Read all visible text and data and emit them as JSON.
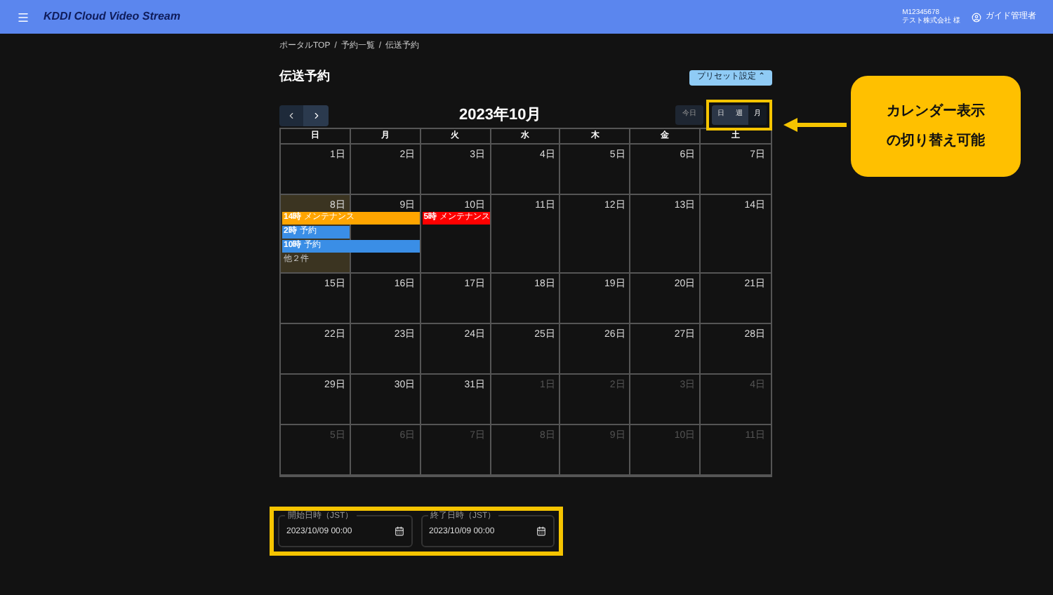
{
  "header": {
    "brand": "KDDI Cloud Video Stream",
    "account_id": "M12345678",
    "company": "テスト株式会社 様",
    "user": "ガイド管理者"
  },
  "breadcrumb": [
    "ポータルTOP",
    "予約一覧",
    "伝送予約"
  ],
  "breadcrumb_separator": "/",
  "page_title": "伝送予約",
  "preset_button": "プリセット設定 ⌃",
  "calendar": {
    "title": "2023年10月",
    "today_button": "今日",
    "views": [
      {
        "label": "日",
        "selected": false
      },
      {
        "label": "週",
        "selected": false
      },
      {
        "label": "月",
        "selected": true
      }
    ],
    "weekdays": [
      "日",
      "月",
      "火",
      "水",
      "木",
      "金",
      "土"
    ],
    "weeks": [
      {
        "days": [
          {
            "label": "1日",
            "muted": false,
            "today": false
          },
          {
            "label": "2日",
            "muted": false,
            "today": false
          },
          {
            "label": "3日",
            "muted": false,
            "today": false
          },
          {
            "label": "4日",
            "muted": false,
            "today": false
          },
          {
            "label": "5日",
            "muted": false,
            "today": false
          },
          {
            "label": "6日",
            "muted": false,
            "today": false
          },
          {
            "label": "7日",
            "muted": false,
            "today": false
          }
        ]
      },
      {
        "days": [
          {
            "label": "8日",
            "muted": false,
            "today": true,
            "events": [
              {
                "time": "14時",
                "title": "メンテナンス",
                "color": "#ffa500",
                "continues": true
              },
              {
                "time": "2時",
                "title": "予約",
                "color": "#3a8ee6",
                "continues": false
              },
              {
                "time": "10時",
                "title": "予約",
                "color": "#3a8ee6",
                "continues": true
              }
            ],
            "more": "他２件"
          },
          {
            "label": "9日",
            "muted": false,
            "today": false
          },
          {
            "label": "10日",
            "muted": false,
            "today": false,
            "events": [
              {
                "time": "5時",
                "title": "メンテナンス",
                "color": "#ff0000",
                "continues": false
              }
            ]
          },
          {
            "label": "11日",
            "muted": false,
            "today": false
          },
          {
            "label": "12日",
            "muted": false,
            "today": false
          },
          {
            "label": "13日",
            "muted": false,
            "today": false
          },
          {
            "label": "14日",
            "muted": false,
            "today": false
          }
        ]
      },
      {
        "days": [
          {
            "label": "15日",
            "muted": false,
            "today": false
          },
          {
            "label": "16日",
            "muted": false,
            "today": false
          },
          {
            "label": "17日",
            "muted": false,
            "today": false
          },
          {
            "label": "18日",
            "muted": false,
            "today": false
          },
          {
            "label": "19日",
            "muted": false,
            "today": false
          },
          {
            "label": "20日",
            "muted": false,
            "today": false
          },
          {
            "label": "21日",
            "muted": false,
            "today": false
          }
        ]
      },
      {
        "days": [
          {
            "label": "22日",
            "muted": false,
            "today": false
          },
          {
            "label": "23日",
            "muted": false,
            "today": false
          },
          {
            "label": "24日",
            "muted": false,
            "today": false
          },
          {
            "label": "25日",
            "muted": false,
            "today": false
          },
          {
            "label": "26日",
            "muted": false,
            "today": false
          },
          {
            "label": "27日",
            "muted": false,
            "today": false
          },
          {
            "label": "28日",
            "muted": false,
            "today": false
          }
        ]
      },
      {
        "days": [
          {
            "label": "29日",
            "muted": false,
            "today": false
          },
          {
            "label": "30日",
            "muted": false,
            "today": false
          },
          {
            "label": "31日",
            "muted": false,
            "today": false
          },
          {
            "label": "1日",
            "muted": true,
            "today": false
          },
          {
            "label": "2日",
            "muted": true,
            "today": false
          },
          {
            "label": "3日",
            "muted": true,
            "today": false
          },
          {
            "label": "4日",
            "muted": true,
            "today": false
          }
        ]
      },
      {
        "days": [
          {
            "label": "5日",
            "muted": true,
            "today": false
          },
          {
            "label": "6日",
            "muted": true,
            "today": false
          },
          {
            "label": "7日",
            "muted": true,
            "today": false
          },
          {
            "label": "8日",
            "muted": true,
            "today": false
          },
          {
            "label": "9日",
            "muted": true,
            "today": false
          },
          {
            "label": "10日",
            "muted": true,
            "today": false
          },
          {
            "label": "11日",
            "muted": true,
            "today": false
          }
        ]
      }
    ]
  },
  "date_fields": [
    {
      "label": "開始日時（JST）",
      "value": "2023/10/09 00:00"
    },
    {
      "label": "終了日時（JST）",
      "value": "2023/10/09 00:00"
    }
  ],
  "callout": {
    "lines": [
      "カレンダー表示",
      "の切り替え可能"
    ]
  }
}
